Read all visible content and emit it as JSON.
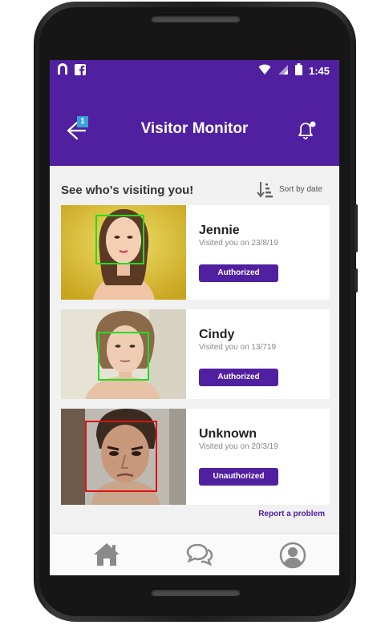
{
  "statusbar": {
    "time": "1:45",
    "icons": [
      "n-app-icon",
      "facebook-icon",
      "wifi-icon",
      "signal-icon",
      "battery-icon"
    ]
  },
  "appbar": {
    "title": "Visitor Monitor",
    "back_badge": "1"
  },
  "main": {
    "heading": "See who's visiting you!",
    "sort_label": "Sort by date",
    "visitors": [
      {
        "name": "Jennie",
        "visited": "Visited you on 23/8/19",
        "status": "Authorized",
        "box_color": "#22dd22"
      },
      {
        "name": "Cindy",
        "visited": "Visited you on 13/719",
        "status": "Authorized",
        "box_color": "#22dd22"
      },
      {
        "name": "Unknown",
        "visited": "Visited you on 20/3/19",
        "status": "Unauthorized",
        "box_color": "#e01010"
      }
    ],
    "report_link": "Report a problem"
  },
  "bottom_nav": [
    "home-icon",
    "chat-icon",
    "profile-icon"
  ],
  "colors": {
    "primary": "#5020a0",
    "background": "#f1f1f1"
  }
}
